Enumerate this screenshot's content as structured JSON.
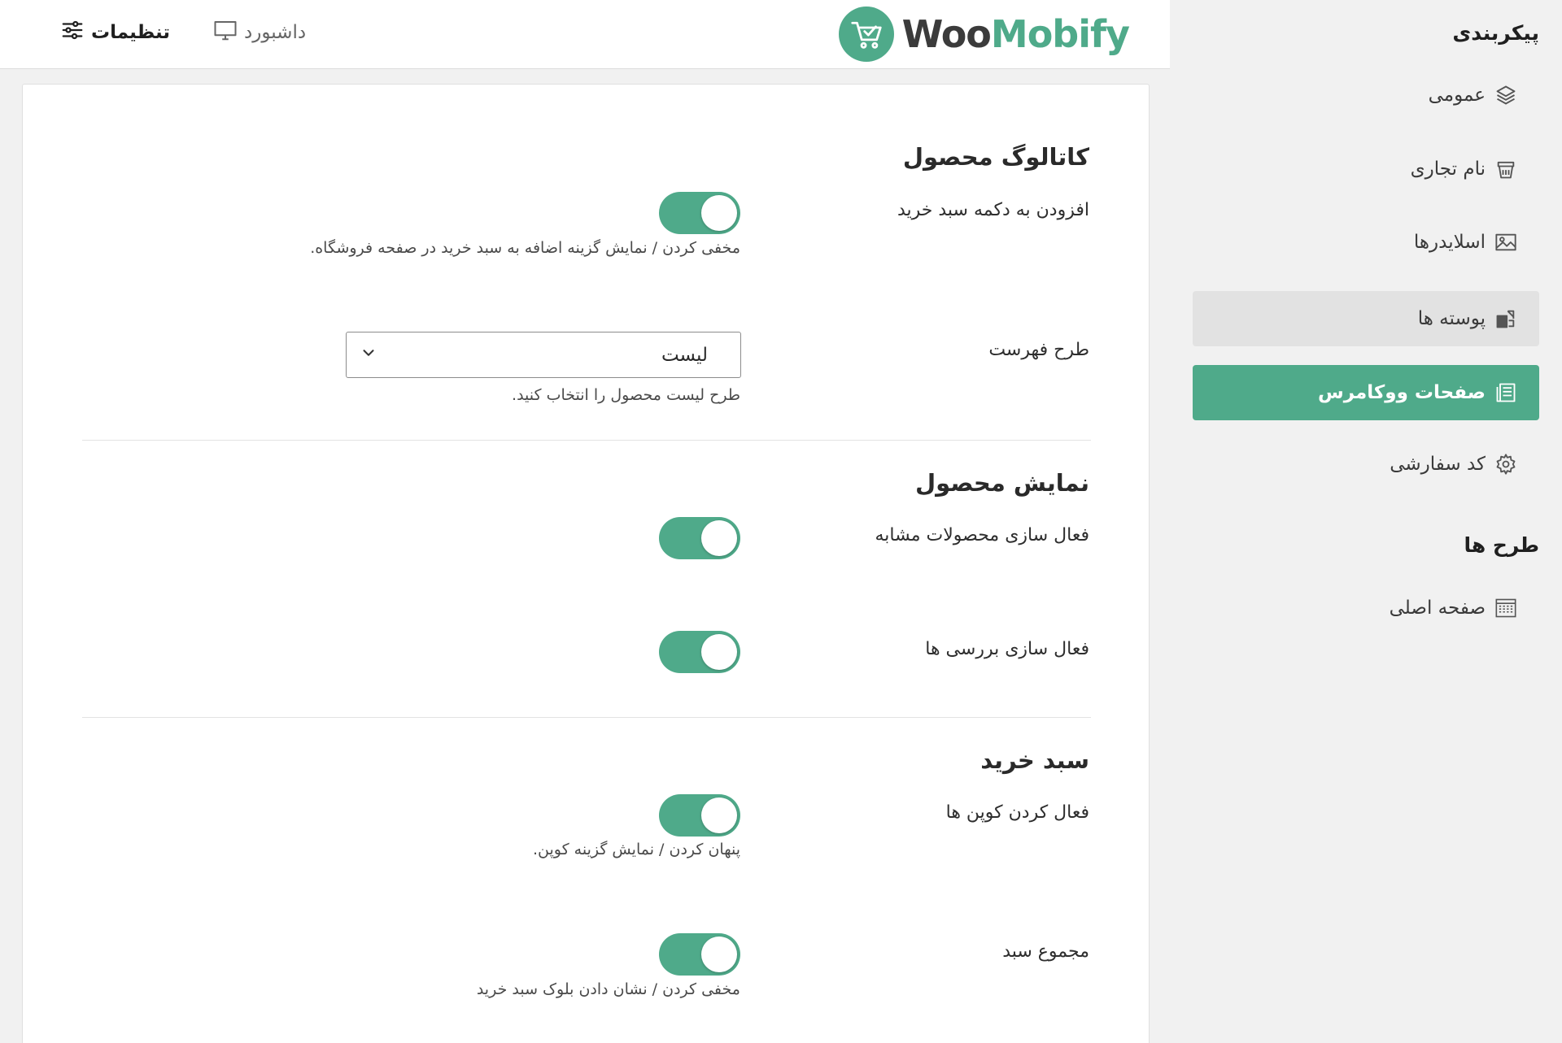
{
  "sidebar": {
    "heading_config": "پیکربندی",
    "items": [
      {
        "label": "عمومی",
        "icon": "layers-icon"
      },
      {
        "label": "نام تجاری",
        "icon": "brand-icon"
      },
      {
        "label": "اسلایدرها",
        "icon": "image-icon"
      },
      {
        "label": "پوسته ها",
        "icon": "skin-icon"
      },
      {
        "label": "صفحات ووکامرس",
        "icon": "pages-icon"
      },
      {
        "label": "کد سفارشی",
        "icon": "gear-icon"
      }
    ],
    "heading_layouts": "طرح ها",
    "layout_items": [
      {
        "label": "صفحه اصلی",
        "icon": "grid-icon"
      }
    ],
    "active_index": 4,
    "hover_index": 3
  },
  "topbar": {
    "logo_woo": "Woo",
    "logo_mobify": "Mobify",
    "dashboard_label": "داشبورد",
    "settings_label": "تنظیمات"
  },
  "content": {
    "catalog": {
      "title": "کاتالوگ محصول",
      "add_to_cart_label": "افزودن به دکمه سبد خرید",
      "add_to_cart_on": true,
      "add_to_cart_help": "مخفی کردن / نمایش گزینه اضافه به سبد خرید در صفحه فروشگاه.",
      "list_layout_label": "طرح فهرست",
      "list_layout_value": "لیست",
      "list_layout_help": "طرح لیست محصول را انتخاب کنید."
    },
    "product_display": {
      "title": "نمایش محصول",
      "related_label": "فعال سازی محصولات مشابه",
      "related_on": true,
      "reviews_label": "فعال سازی بررسی ها",
      "reviews_on": true
    },
    "cart": {
      "title": "سبد خرید",
      "coupons_label": "فعال کردن کوپن ها",
      "coupons_on": true,
      "coupons_help": "پنهان کردن / نمایش گزینه کوپن.",
      "total_label": "مجموع سبد",
      "total_on": true,
      "total_help": "مخفی کردن / نشان دادن بلوک سبد خرید"
    }
  },
  "colors": {
    "accent": "#4faa8a",
    "sidebar_bg": "#f1f1f1",
    "hover_bg": "#e2e2e2"
  }
}
